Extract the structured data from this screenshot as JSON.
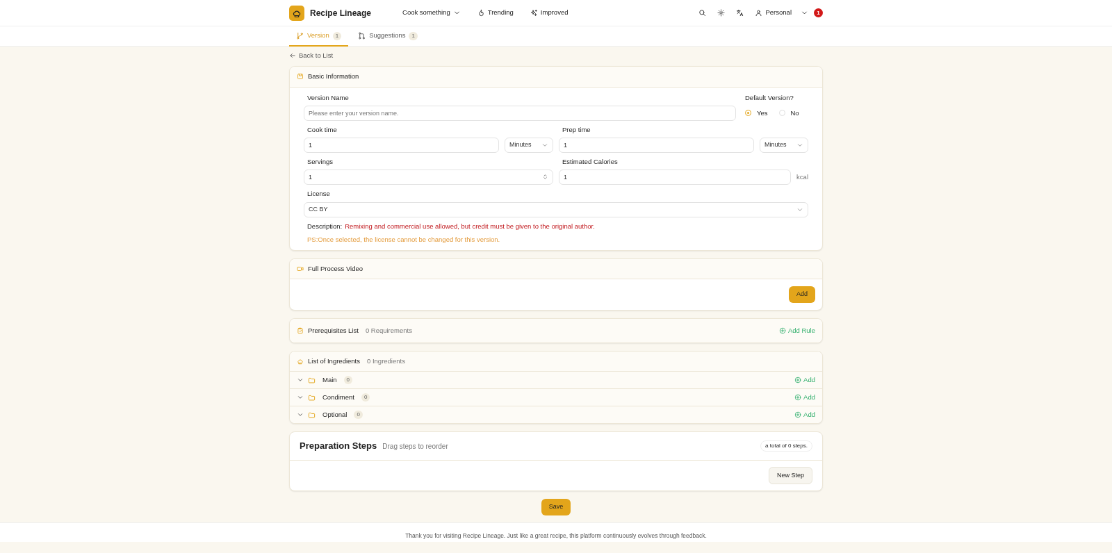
{
  "navbar": {
    "brand": "Recipe Lineage",
    "links": [
      {
        "label": "Cook something",
        "kind": "dropdown"
      },
      {
        "label": "Trending",
        "kind": "flame"
      },
      {
        "label": "Improved",
        "kind": "sparkle"
      }
    ],
    "user": "Personal",
    "notifications": "1"
  },
  "tabs": [
    {
      "label": "Version",
      "count": "1",
      "selected": true
    },
    {
      "label": "Suggestions",
      "count": "1",
      "selected": false
    }
  ],
  "back_link": "Back to List",
  "basic_info": {
    "title": "Basic Information",
    "version_name": {
      "label": "Version Name",
      "placeholder": "Please enter your version name."
    },
    "default_version": {
      "label": "Default Version?",
      "options": [
        {
          "label": "Yes",
          "selected": true
        },
        {
          "label": "No",
          "selected": false
        }
      ]
    },
    "cook_time": {
      "label": "Cook time",
      "value": "1",
      "unit": "Minutes"
    },
    "prep_time": {
      "label": "Prep time",
      "value": "1",
      "unit": "Minutes"
    },
    "servings": {
      "label": "Servings",
      "value": "1"
    },
    "calories": {
      "label": "Estimated Calories",
      "value": "1",
      "unit": "kcal"
    },
    "license": {
      "label": "License",
      "value": "CC BY",
      "description_label": "Description:",
      "description": "Remixing and commercial use allowed, but credit must be given to the original author.",
      "note": "PS:Once selected, the license cannot be changed for this version."
    }
  },
  "video": {
    "title": "Full Process Video",
    "button": "Add"
  },
  "prerequisites": {
    "title": "Prerequisites List",
    "count": "0 Requirements",
    "action": "Add Rule"
  },
  "ingredients": {
    "title": "List of Ingredients",
    "count": "0 Ingredients",
    "groups": [
      {
        "name": "Main",
        "count": "0",
        "action": "Add",
        "expanded": false
      },
      {
        "name": "Condiment",
        "count": "0",
        "action": "Add",
        "expanded": false
      },
      {
        "name": "Optional",
        "count": "0",
        "action": "Add",
        "expanded": false
      }
    ]
  },
  "steps": {
    "title": "Preparation Steps",
    "hint": "Drag steps to reorder",
    "total": "a total of 0 steps.",
    "button": "New Step"
  },
  "save": "Save",
  "footer": "Thank you for visiting Recipe Lineage. Just like a great recipe, this platform continuously evolves through feedback."
}
